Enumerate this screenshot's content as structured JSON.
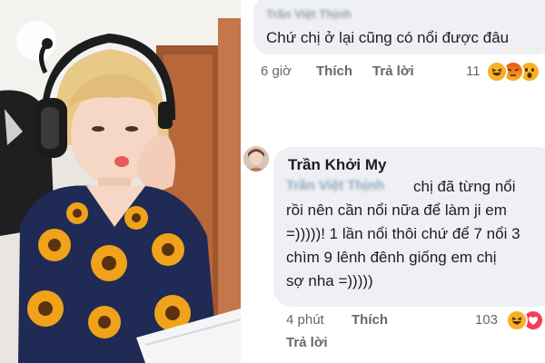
{
  "comment1": {
    "author": "Trần Việt Thịnh",
    "text": "Chứ chị ở lại cũng có nổi được đâu",
    "time": "6 giờ",
    "like_label": "Thích",
    "reply_label": "Trả lời",
    "reaction_count": "11",
    "reactions": [
      "haha-icon",
      "angry-icon",
      "wow-icon"
    ]
  },
  "comment2": {
    "author": "Trần Khởi My",
    "mention": "Trần Việt Thịnh",
    "lines": [
      "chị đã từng nổi",
      "rồi nên cần nổi nữa để làm ji em",
      "=)))))! 1 lần nổi thôi chứ để 7 nổi 3",
      "chìm 9 lênh đênh giống em chị",
      "sợ nha =)))))"
    ],
    "time": "4 phút",
    "like_label": "Thích",
    "reply_label": "Trả lời",
    "reaction_count": "103",
    "reactions": [
      "haha-icon",
      "love-icon"
    ]
  },
  "colors": {
    "bubble": "#eef0f3",
    "text": "#1c1e21",
    "meta": "#65676b",
    "love": "#f33e58",
    "haha": "#f7b125",
    "angry": "#e9710f"
  }
}
